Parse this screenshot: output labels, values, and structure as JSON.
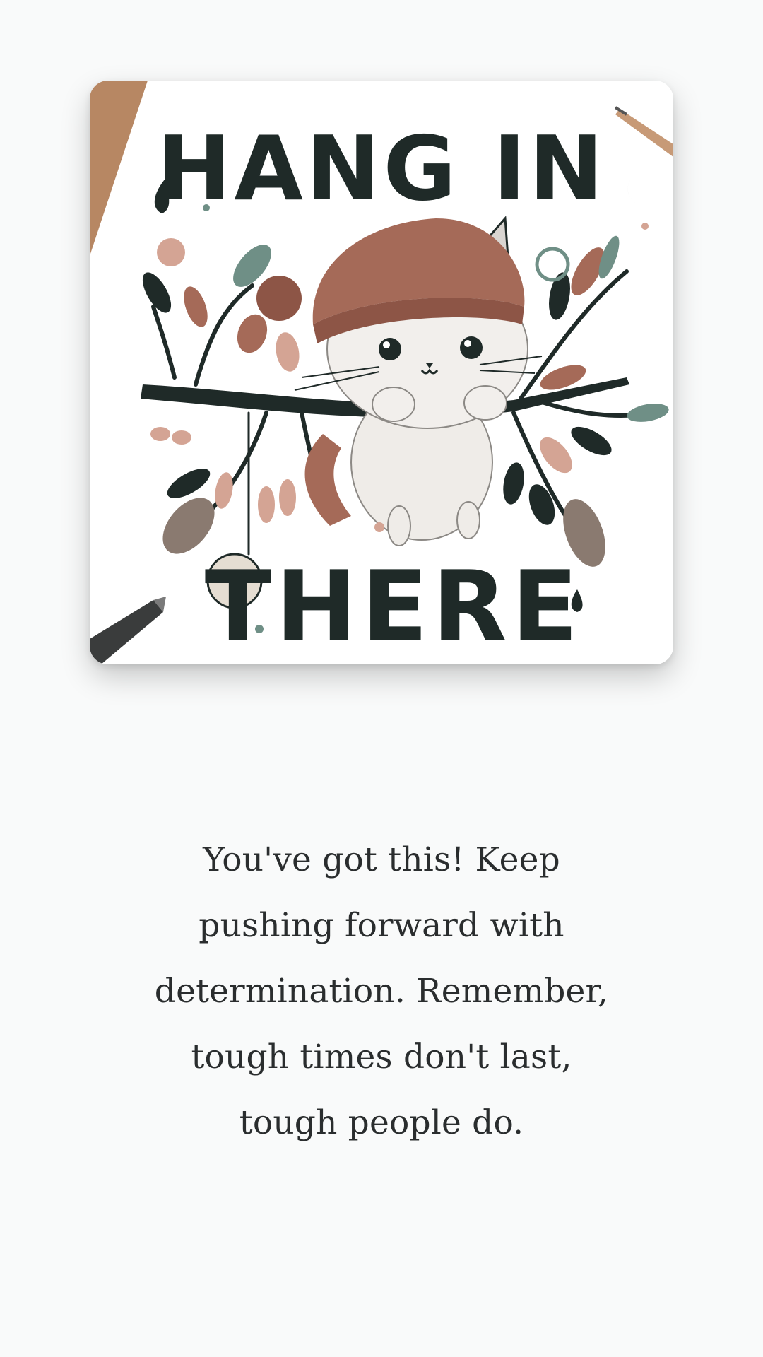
{
  "card": {
    "poster_text_line1": "HANG IN",
    "poster_text_line2": "THERE",
    "illustration": "kitten-in-knit-hat-hanging-from-branch",
    "colors": {
      "ink": "#1f2a28",
      "rust": "#a56a58",
      "sage": "#6f8f86",
      "blush": "#d4a494",
      "kraft": "#b78763"
    }
  },
  "quote": {
    "lines": [
      "You've got this! Keep",
      "pushing forward with",
      "determination. Remember,",
      "tough times don't last,",
      "tough people do."
    ]
  }
}
